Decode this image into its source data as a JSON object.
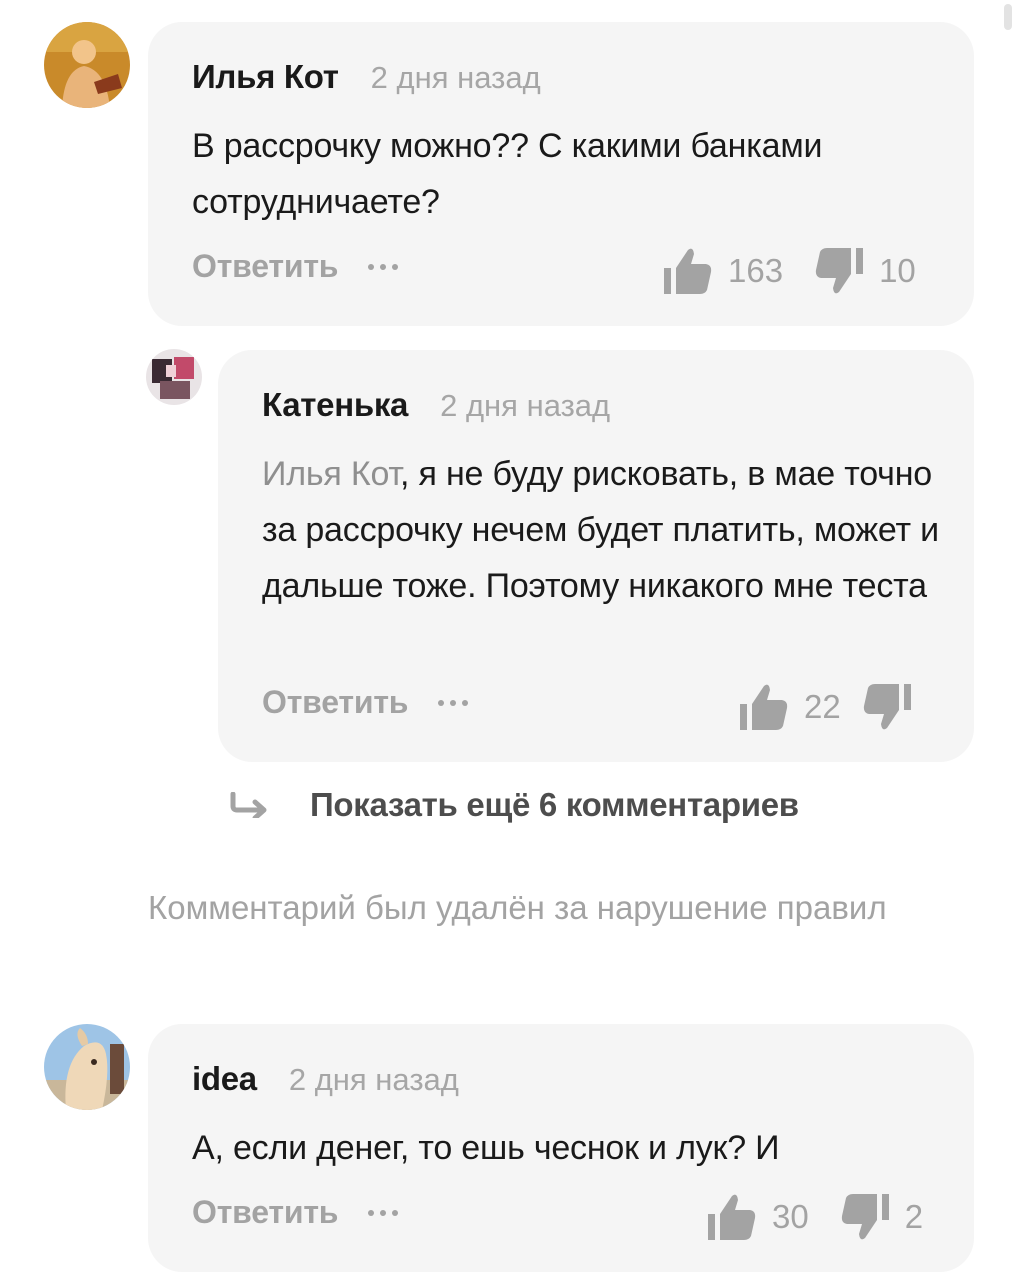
{
  "comments": [
    {
      "author": "Илья Кот",
      "time": "2 дня назад",
      "text": "В рассрочку можно?? С какими банками сотрудничаете?",
      "reply_label": "Ответить",
      "likes": "163",
      "dislikes": "10"
    },
    {
      "author": "Катенька",
      "time": "2 дня назад",
      "mention": "Илья Кот",
      "text": ", я не буду рисковать, в мае точно за рассрочку нечем будет платить, может и дальше тоже. Поэтому никакого мне теста",
      "reply_label": "Ответить",
      "likes": "22",
      "dislikes": ""
    },
    {
      "author": "idea",
      "time": "2 дня назад",
      "text": "А, если денег, то ешь чеснок и лук? И",
      "reply_label": "Ответить",
      "likes": "30",
      "dislikes": "2"
    }
  ],
  "show_more": {
    "label": "Показать ещё 6 комментариев"
  },
  "deleted_notice": "Комментарий был удалён за нарушение правил",
  "icons": {
    "like": "thumbs-up-icon",
    "dislike": "thumbs-down-icon",
    "more": "more-dots-icon",
    "show_more": "reply-arrow-icon"
  },
  "colors": {
    "bubble": "#f5f5f5",
    "muted": "#a3a3a3",
    "text": "#1a1a1a"
  }
}
